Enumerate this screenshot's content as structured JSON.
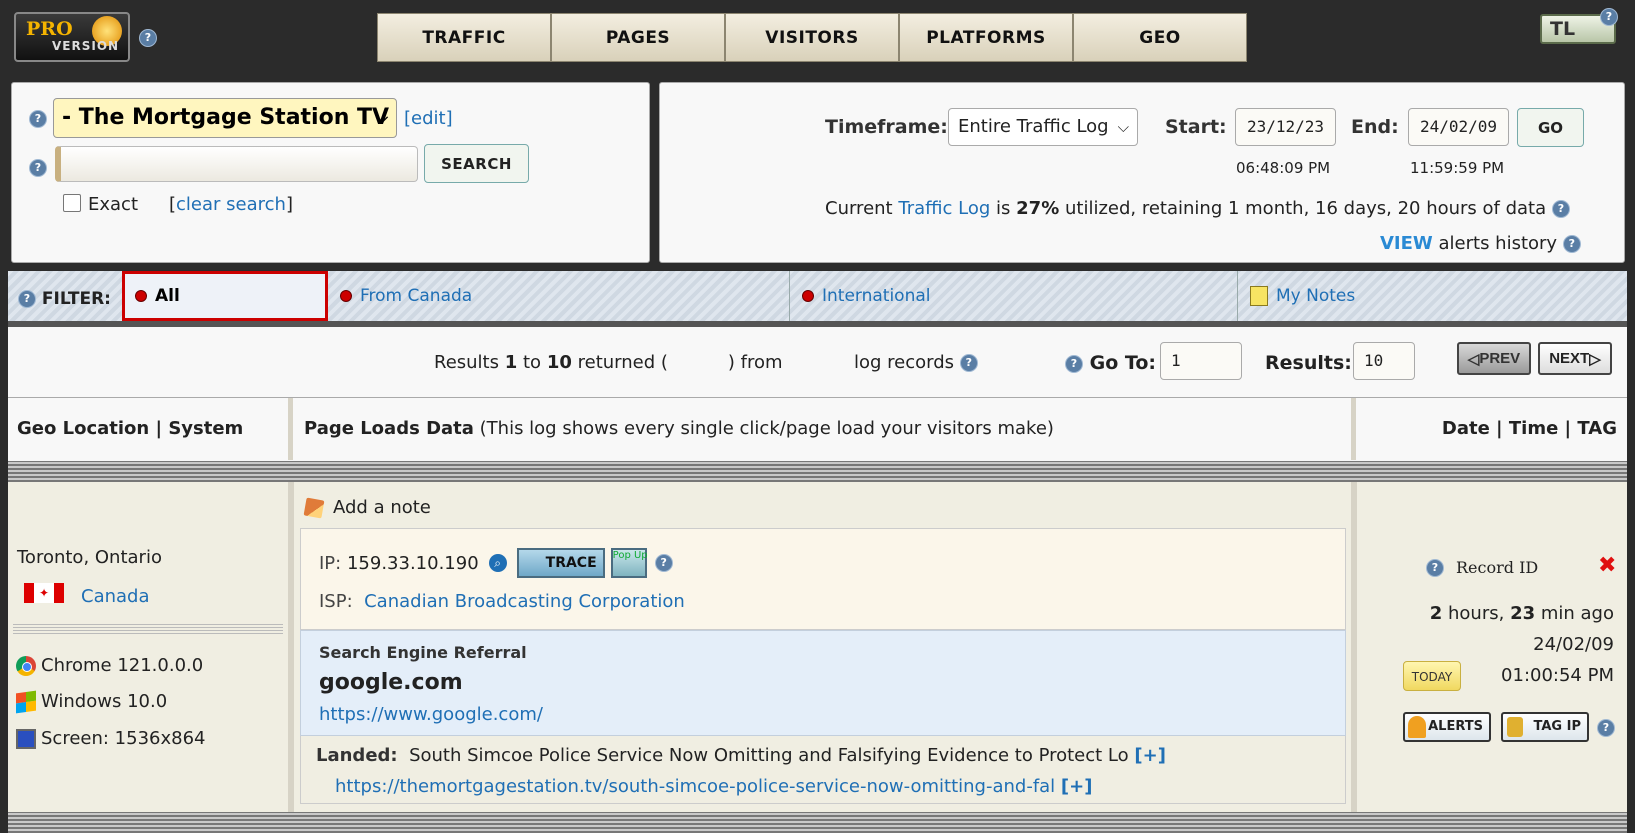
{
  "header": {
    "pro_logo_line1": "PRO",
    "pro_logo_line2": "VERSION",
    "tl_logo": "TL",
    "nav": [
      "TRAFFIC",
      "PAGES",
      "VISITORS",
      "PLATFORMS",
      "GEO"
    ]
  },
  "search": {
    "site_selected": "- The Mortgage Station TV",
    "edit_label": "[edit]",
    "search_value": "",
    "search_button": "SEARCH",
    "exact_label": "Exact",
    "exact_checked": false,
    "clear_search_label": "clear search"
  },
  "timeframe": {
    "label": "Timeframe:",
    "selected": "Entire Traffic Log",
    "start_label": "Start:",
    "start_date": "23/12/23",
    "start_time": "06:48:09 PM",
    "end_label": "End:",
    "end_date": "24/02/09",
    "end_time": "11:59:59 PM",
    "go_button": "GO",
    "util_prefix": "Current",
    "util_link": "Traffic Log",
    "util_is": "is",
    "util_percent": "27%",
    "util_suffix": "utilized, retaining 1 month, 16 days, 20 hours of data",
    "view_label": "VIEW",
    "alerts_history": "alerts history"
  },
  "filter": {
    "label": "FILTER:",
    "tabs": [
      "All",
      "From Canada",
      "International",
      "My Notes"
    ]
  },
  "results": {
    "prefix": "Results",
    "from": "1",
    "to_word": "to",
    "to": "10",
    "returned": "returned (",
    "from_word": ") from",
    "log_records": "log records",
    "goto_label": "Go To:",
    "goto_value": "1",
    "results_label": "Results:",
    "results_value": "10",
    "prev": "PREV",
    "next": "NEXT"
  },
  "columns": {
    "geo": "Geo Location | System",
    "page_bold": "Page Loads Data",
    "page_desc": "(This log shows every single click/page load your visitors make)",
    "date": "Date | Time | TAG"
  },
  "record": {
    "city": "Toronto, Ontario",
    "country": "Canada",
    "browser": "Chrome 121.0.0.0",
    "os": "Windows 10.0",
    "screen": "Screen: 1536x864",
    "add_note": "Add a note",
    "ip_label": "IP:",
    "ip": "159.33.10.190",
    "trace_label": "TRACE",
    "popup_label": "Pop Up",
    "isp_label": "ISP:",
    "isp": "Canadian Broadcasting Corporation",
    "ref_label": "Search Engine Referral",
    "ref_domain": "google.com",
    "ref_url": "https://www.google.com/",
    "landed_label": "Landed:",
    "landed_title": "South Simcoe Police Service Now Omitting and Falsifying Evidence to Protect Lo",
    "landed_url": "https://themortgagestation.tv/south-simcoe-police-service-now-omitting-and-fal",
    "expand": "[+]",
    "record_id_label": "Record ID",
    "ago_hours": "2",
    "ago_hours_word": "hours,",
    "ago_mins": "23",
    "ago_mins_word": "min ago",
    "date": "24/02/09",
    "today": "TODAY",
    "time": "01:00:54 PM",
    "alerts_btn": "ALERTS",
    "tagip_btn": "TAG IP"
  },
  "icons": {
    "help": "?",
    "delete": "✖",
    "chevron": "⌵",
    "prev_arrow": "◁",
    "next_arrow": "▷"
  },
  "colors": {
    "link": "#1f6fb5",
    "active_filter_border": "#cc0000",
    "site_select_bg": "#fff6bf"
  }
}
